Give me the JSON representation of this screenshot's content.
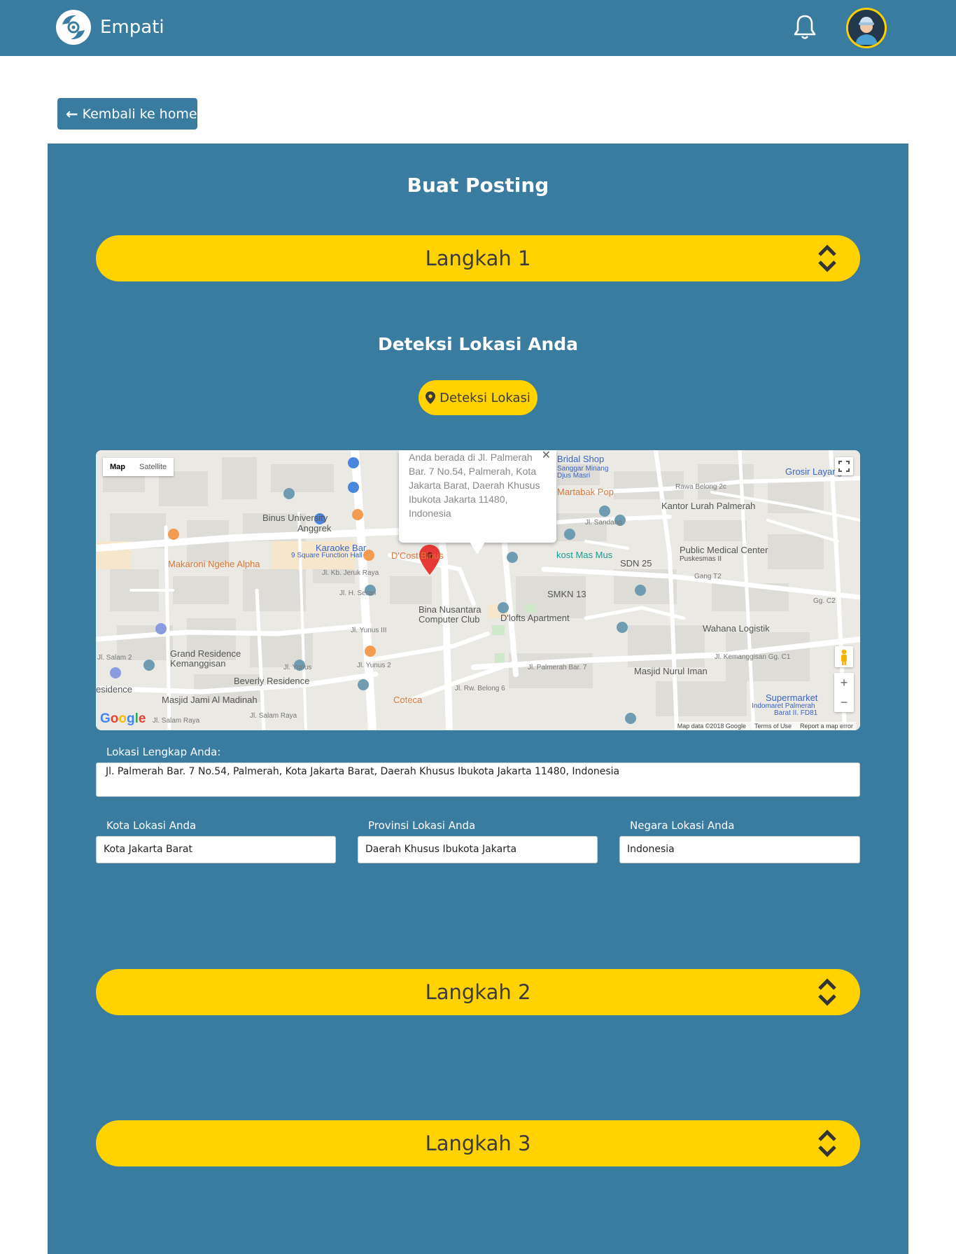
{
  "navbar": {
    "brand_name": "Empati",
    "brand_color": "#3a7ca0"
  },
  "back_button": {
    "label": "Kembali ke home"
  },
  "page": {
    "title": "Buat Posting"
  },
  "steps": [
    {
      "label": "Langkah 1"
    },
    {
      "label": "Langkah 2"
    },
    {
      "label": "Langkah 3"
    }
  ],
  "location": {
    "heading": "Deteksi Lokasi Anda",
    "detect_button": "Deteksi Lokasi"
  },
  "map": {
    "type_map": "Map",
    "type_satellite": "Satellite",
    "info_window": "Anda berada di Jl. Palmerah Bar. 7 No.54, Palmerah, Kota Jakarta Barat, Daerah Khusus Ibukota Jakarta 11480, Indonesia",
    "labels": {
      "bridal_shop": "Bridal Shop",
      "sanggar": "Sanggar Minang",
      "djus": "Djus Masri",
      "grosir": "Grosir Layangan",
      "martabak": "Martabak Pop",
      "rawa_belong": "Rawa Belong 2c",
      "kantor_lurah": "Kantor Lurah Palmerah",
      "binus": "Binus University",
      "anggrek": "Anggrek",
      "jl_sandang": "Jl. Sandang",
      "karaoke": "Karaoke Bar",
      "nine_square": "9 Square Function Hall",
      "dcost": "D'Cost Binus",
      "kost": "kost Mas Mus",
      "public_medical": "Public Medical Center",
      "puskesmas": "Puskesmas II",
      "makaroni": "Makaroni Ngehe Alpha",
      "jl_kb_jeruk": "Jl. Kb. Jeruk Raya",
      "sdn": "SDN 25",
      "smkn": "SMKN 13",
      "gang": "Gang T2",
      "jl_h_seran": "Jl. H. Seran",
      "gg_c2": "Gg. C2",
      "bina": "Bina Nusantara",
      "computer_club": "Computer Club",
      "dlofts": "D'lofts Apartment",
      "wahana": "Wahana Logistik",
      "jl_yunus3": "Jl. Yunus III",
      "jl_salam2": "Jl. Salam 2",
      "grand_res": "Grand Residence",
      "kemanggisan": "Kemanggisan",
      "jl_yunus": "Jl. Yunus",
      "jl_yunus2": "Jl. Yunus 2",
      "palmerah7": "Jl. Palmerah Bar. 7",
      "kemanggisan_gg": "Jl. Kemanggisan Gg. C1",
      "masjid_nurul": "Masjid Nurul Iman",
      "beverly": "Beverly Residence",
      "residence": "esidence",
      "masjid_jami": "Masjid Jami Al Madinah",
      "coteca": "Coteca",
      "rw_belong": "Jl. Rw. Belong 6",
      "supermarket": "Supermarket",
      "indomaret": "Indomaret Palmerah",
      "indomaret2": "Barat II. FD81",
      "jl_salam_raya": "Jl. Salam Raya",
      "jl_salam_raya2": "Jl. Salam Raya"
    },
    "google": "Google",
    "footer_data": "Map data ©2018 Google",
    "footer_terms": "Terms of Use",
    "footer_report": "Report a map error"
  },
  "form": {
    "full_address_label": "Lokasi Lengkap Anda:",
    "full_address_value": "Jl. Palmerah Bar. 7 No.54, Palmerah, Kota Jakarta Barat, Daerah Khusus Ibukota Jakarta 11480, Indonesia",
    "city_label": "Kota Lokasi Anda",
    "city_value": "Kota Jakarta Barat",
    "province_label": "Provinsi Lokasi Anda",
    "province_value": "Daerah Khusus Ibukota Jakarta",
    "country_label": "Negara Lokasi Anda",
    "country_value": "Indonesia"
  },
  "colors": {
    "primary": "#3a7ca0",
    "accent": "#ffd200",
    "pin": "#e53935"
  }
}
